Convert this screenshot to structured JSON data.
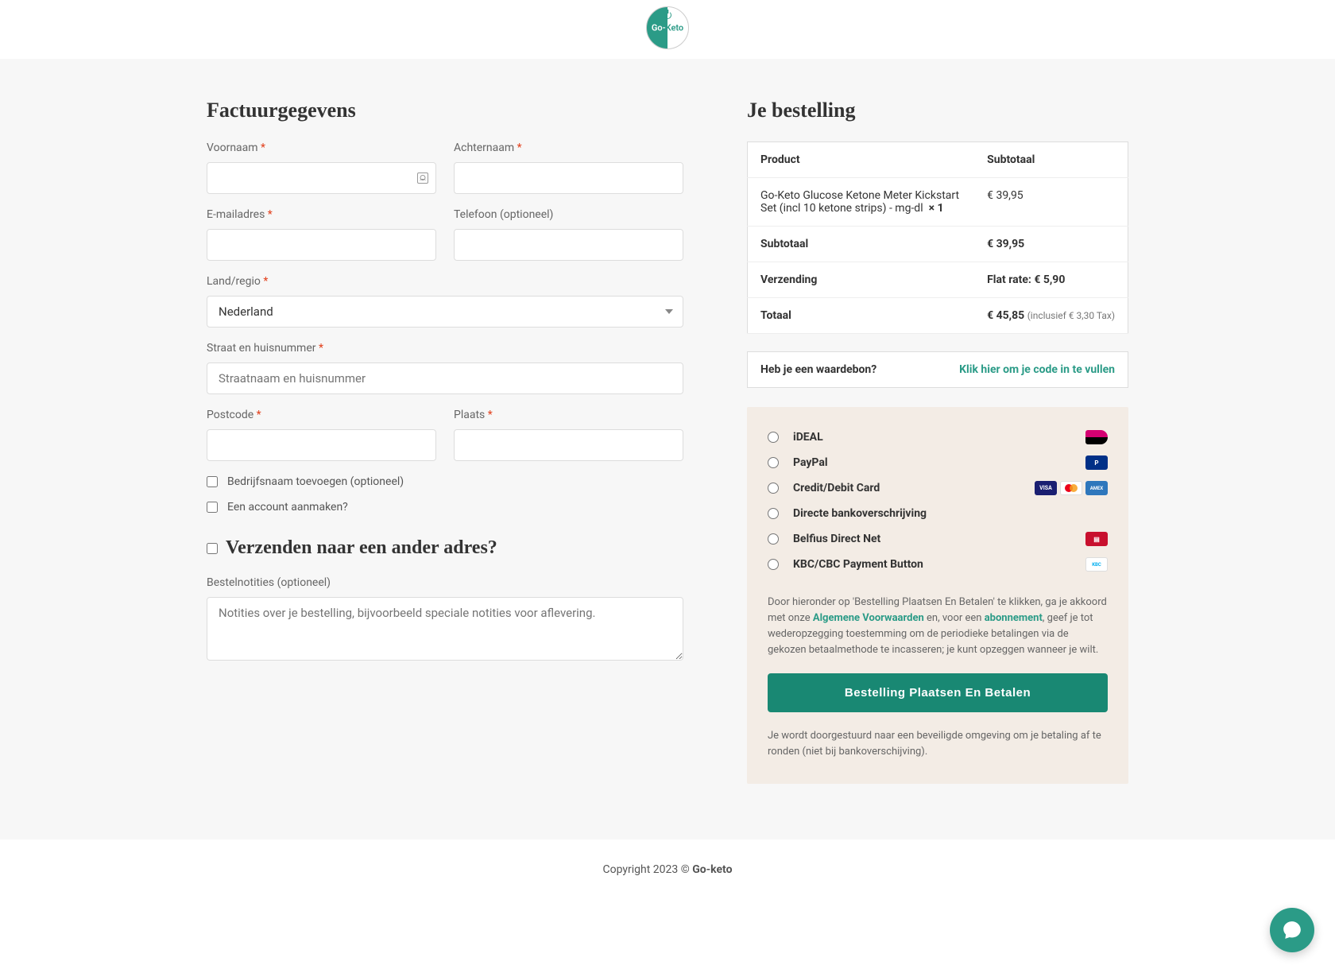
{
  "brand": {
    "name_part1": "Go-",
    "name_part2": "Keto"
  },
  "billing": {
    "title": "Factuurgegevens",
    "first_name_label": "Voornaam",
    "last_name_label": "Achternaam",
    "email_label": "E-mailadres",
    "phone_label": "Telefoon (optioneel)",
    "country_label": "Land/regio",
    "country_selected": "Nederland",
    "street_label": "Straat en huisnummer",
    "street_placeholder": "Straatnaam en huisnummer",
    "postcode_label": "Postcode",
    "city_label": "Plaats",
    "company_checkbox": "Bedrijfsnaam toevoegen (optioneel)",
    "account_checkbox": "Een account aanmaken?",
    "ship_different": "Verzenden naar een ander adres?",
    "notes_label": "Bestelnotities (optioneel)",
    "notes_placeholder": "Notities over je bestelling, bijvoorbeeld speciale notities voor aflevering."
  },
  "order": {
    "title": "Je bestelling",
    "header_product": "Product",
    "header_subtotal": "Subtotaal",
    "item_name": "Go-Keto Glucose Ketone Meter Kickstart Set (incl 10 ketone strips) - mg-dl",
    "item_qty": "× 1",
    "item_price": "€ 39,95",
    "subtotal_label": "Subtotaal",
    "subtotal_value": "€ 39,95",
    "shipping_label": "Verzending",
    "shipping_value": "Flat rate: € 5,90",
    "total_label": "Totaal",
    "total_value": "€ 45,85",
    "tax_note": "(inclusief € 3,30 Tax)"
  },
  "coupon": {
    "question": "Heb je een waardebon?",
    "link": "Klik hier om je code in te vullen"
  },
  "payment": {
    "methods": [
      {
        "label": "iDEAL"
      },
      {
        "label": "PayPal"
      },
      {
        "label": "Credit/Debit Card"
      },
      {
        "label": "Directe bankoverschrijving"
      },
      {
        "label": "Belfius Direct Net"
      },
      {
        "label": "KBC/CBC Payment Button"
      }
    ],
    "terms_pre": "Door hieronder op 'Bestelling Plaatsen En Betalen' te klikken, ga je akkoord met onze ",
    "terms_link1": "Algemene Voorwaarden",
    "terms_mid": " en, voor een ",
    "terms_link2": "abonnement",
    "terms_post": ", geef je tot wederopzegging toestemming om de periodieke betalingen via de gekozen betaalmethode te incasseren; je kunt opzeggen wanneer je wilt.",
    "button": "Bestelling Plaatsen En Betalen",
    "redirect": "Je wordt doorgestuurd naar een beveiligde omgeving om je betaling af te ronden (niet bij bankoverschijving)."
  },
  "footer": {
    "copyright_pre": "Copyright 2023 © ",
    "copyright_brand": "Go-keto"
  }
}
